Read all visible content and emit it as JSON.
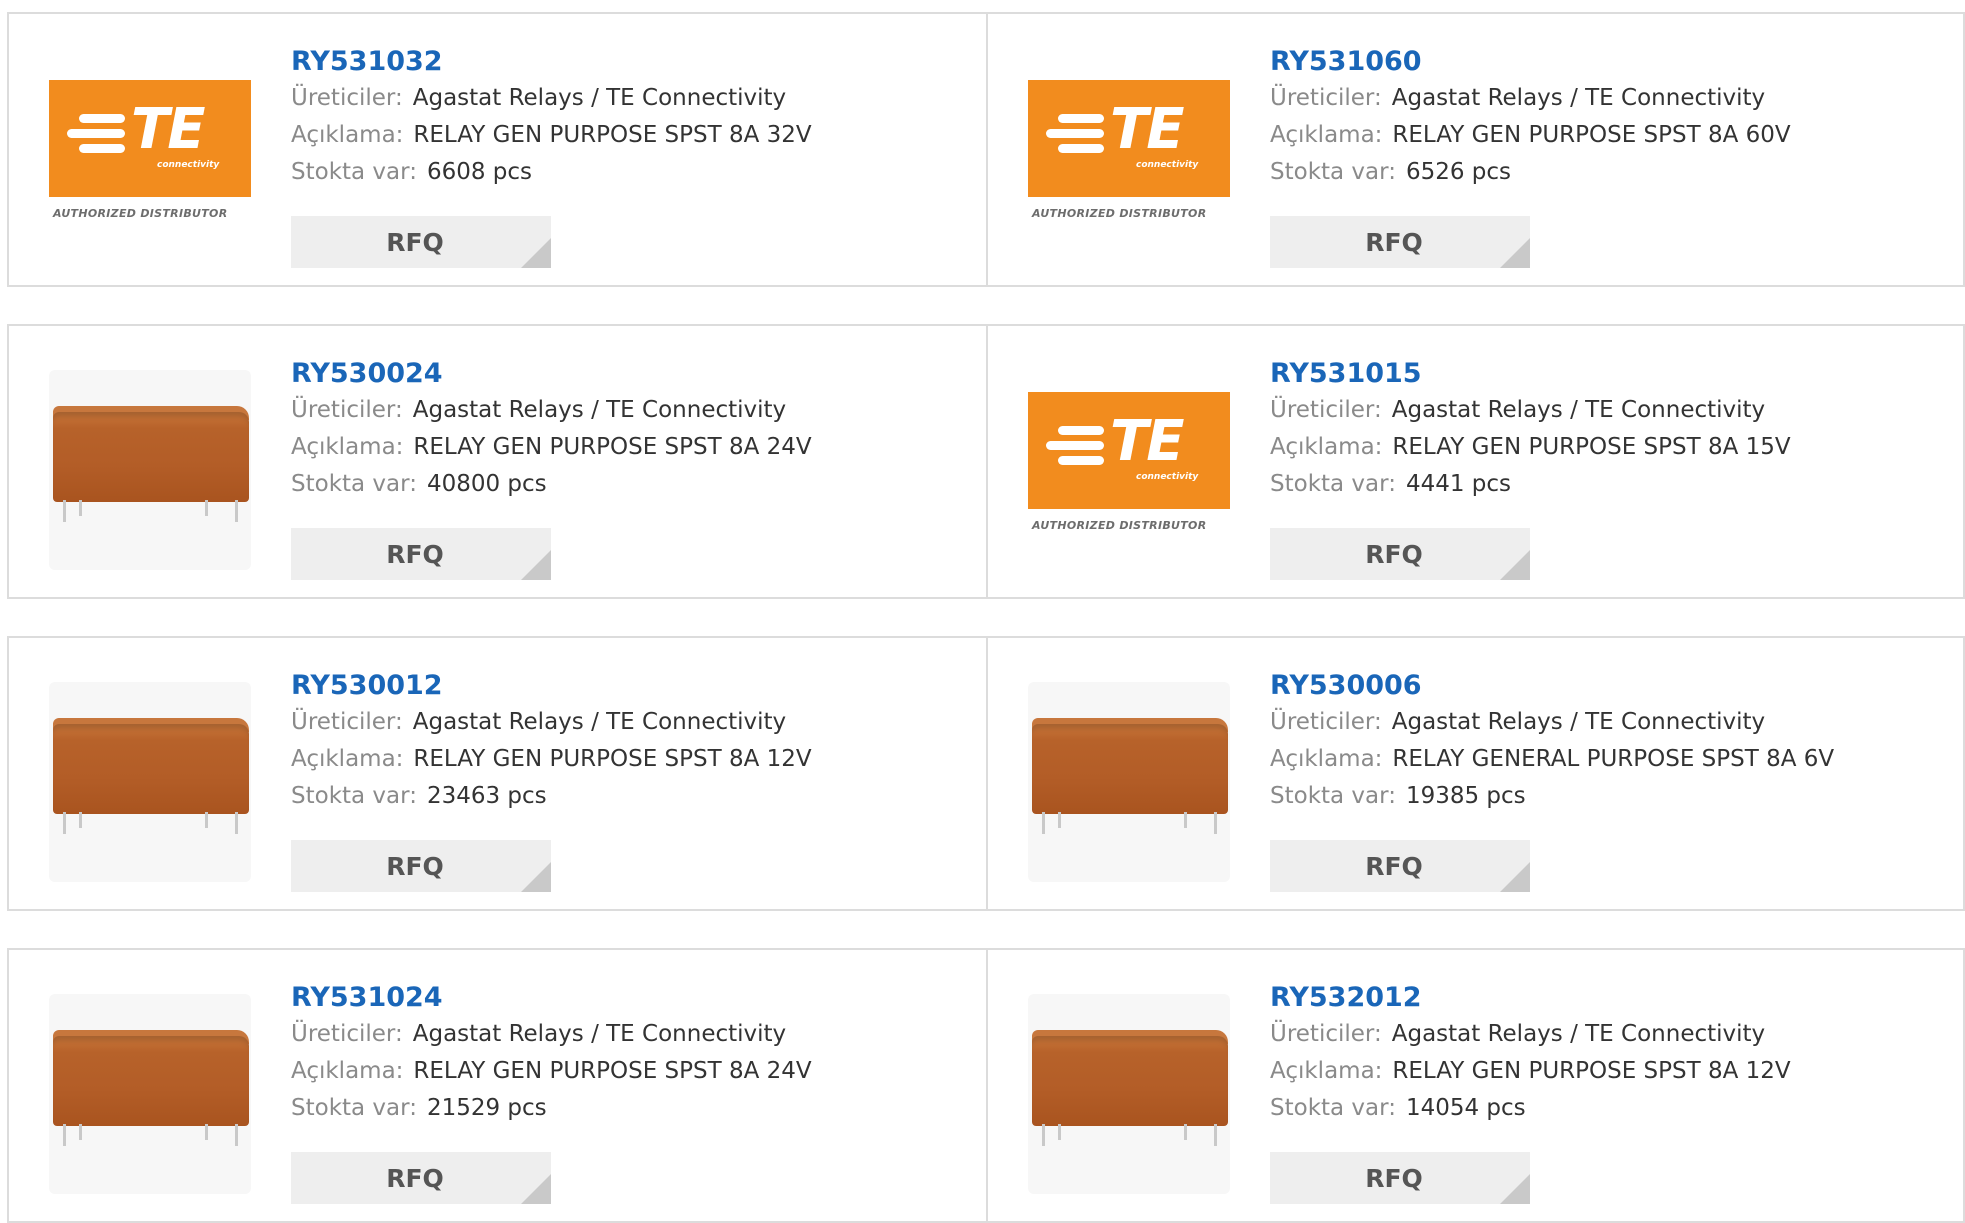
{
  "labels": {
    "manufacturer": "Üreticiler:",
    "description": "Açıklama:",
    "stock": "Stokta var:",
    "rfq": "RFQ"
  },
  "logo": {
    "brand_letters": "TE",
    "brand_sub": "connectivity",
    "authorized": "AUTHORIZED DISTRIBUTOR"
  },
  "colors": {
    "link": "#1a66b8",
    "te_orange": "#f28c1e",
    "relay_body": "#b35d27"
  },
  "rows": [
    {
      "cards": [
        {
          "part": "RY531032",
          "image": "te-logo",
          "manufacturer": "Agastat Relays / TE Connectivity",
          "description": "RELAY GEN PURPOSE SPST 8A 32V",
          "stock": "6608 pcs"
        },
        {
          "part": "RY531060",
          "image": "te-logo",
          "manufacturer": "Agastat Relays / TE Connectivity",
          "description": "RELAY GEN PURPOSE SPST 8A 60V",
          "stock": "6526 pcs"
        }
      ]
    },
    {
      "cards": [
        {
          "part": "RY530024",
          "image": "relay",
          "manufacturer": "Agastat Relays / TE Connectivity",
          "description": "RELAY GEN PURPOSE SPST 8A 24V",
          "stock": "40800 pcs"
        },
        {
          "part": "RY531015",
          "image": "te-logo",
          "manufacturer": "Agastat Relays / TE Connectivity",
          "description": "RELAY GEN PURPOSE SPST 8A 15V",
          "stock": "4441 pcs"
        }
      ]
    },
    {
      "cards": [
        {
          "part": "RY530012",
          "image": "relay",
          "manufacturer": "Agastat Relays / TE Connectivity",
          "description": "RELAY GEN PURPOSE SPST 8A 12V",
          "stock": "23463 pcs"
        },
        {
          "part": "RY530006",
          "image": "relay",
          "manufacturer": "Agastat Relays / TE Connectivity",
          "description": "RELAY GENERAL PURPOSE SPST 8A 6V",
          "stock": "19385 pcs"
        }
      ]
    },
    {
      "cards": [
        {
          "part": "RY531024",
          "image": "relay",
          "manufacturer": "Agastat Relays / TE Connectivity",
          "description": "RELAY GEN PURPOSE SPST 8A 24V",
          "stock": "21529 pcs"
        },
        {
          "part": "RY532012",
          "image": "relay",
          "manufacturer": "Agastat Relays / TE Connectivity",
          "description": "RELAY GEN PURPOSE SPST 8A 12V",
          "stock": "14054 pcs"
        }
      ]
    }
  ]
}
